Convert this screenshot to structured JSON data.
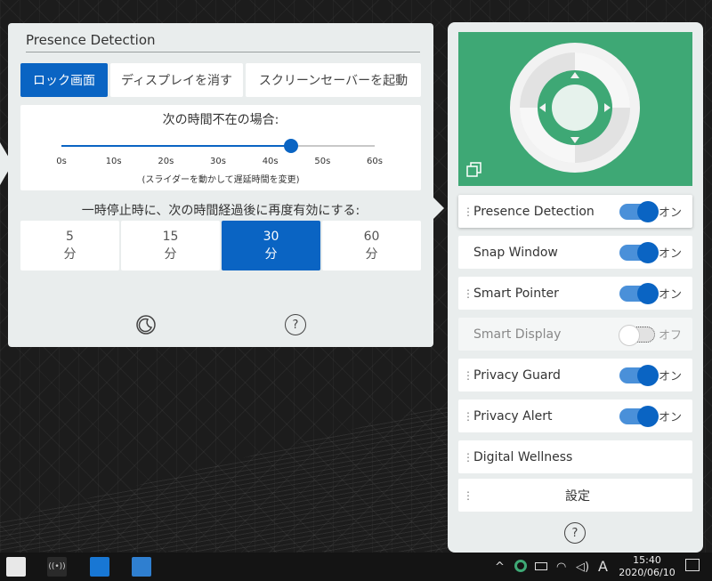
{
  "left_panel": {
    "title": "Presence Detection",
    "actions": [
      {
        "label": "ロック画面",
        "active": true
      },
      {
        "label": "ディスプレイを消す",
        "active": false
      },
      {
        "label": "スクリーンセーバーを起動",
        "active": false
      }
    ],
    "slider": {
      "question": "次の時間不在の場合:",
      "ticks": [
        "0s",
        "10s",
        "20s",
        "30s",
        "40s",
        "50s",
        "60s"
      ],
      "value_seconds": 44,
      "max_seconds": 60,
      "hint": "(スライダーを動かして遅延時間を変更)"
    },
    "pause_label": "一時停止時に、次の時間経過後に再度有効にする:",
    "durations": [
      {
        "value": "5",
        "unit": "分",
        "active": false
      },
      {
        "value": "15",
        "unit": "分",
        "active": false
      },
      {
        "value": "30",
        "unit": "分",
        "active": true
      },
      {
        "value": "60",
        "unit": "分",
        "active": false
      }
    ],
    "icons": {
      "sleep": "moon-icon",
      "help_text": "?"
    }
  },
  "right_panel": {
    "hero_color": "#3ea875",
    "features": [
      {
        "label": "Presence Detection",
        "state": "オン",
        "on": true,
        "grip": true
      },
      {
        "label": "Snap Window",
        "state": "オン",
        "on": true,
        "grip": false
      },
      {
        "label": "Smart Pointer",
        "state": "オン",
        "on": true,
        "grip": true
      },
      {
        "label": "Smart Display",
        "state": "オフ",
        "on": false,
        "grip": false
      },
      {
        "label": "Privacy Guard",
        "state": "オン",
        "on": true,
        "grip": true
      },
      {
        "label": "Privacy Alert",
        "state": "オン",
        "on": true,
        "grip": true
      },
      {
        "label": "Digital Wellness",
        "grip": true
      },
      {
        "label": "設定",
        "grip": true
      }
    ],
    "help_text": "?"
  },
  "taskbar": {
    "time": "15:40",
    "date": "2020/06/10",
    "ime": "A",
    "accent": "#0a64c3"
  }
}
